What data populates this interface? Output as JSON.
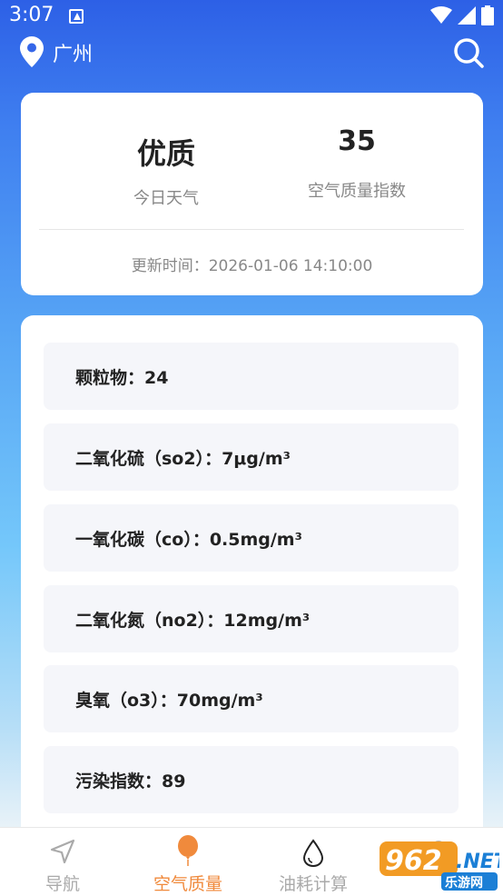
{
  "status_bar": {
    "time": "3:07",
    "icons": [
      "app-notification-icon",
      "wifi-icon",
      "cellular-icon",
      "battery-icon"
    ]
  },
  "header": {
    "city": "广州",
    "icons": [
      "location-pin-icon",
      "search-icon"
    ]
  },
  "summary": {
    "quality": "优质",
    "quality_label": "今日天气",
    "aqi": "35",
    "aqi_label": "空气质量指数",
    "update_label": "更新时间：",
    "update_time": "2026-01-06 14:10:00"
  },
  "pollutants": [
    {
      "label": "颗粒物：24"
    },
    {
      "label": "二氧化硫（so2）：7μg/m³"
    },
    {
      "label": "一氧化碳（co）：0.5mg/m³"
    },
    {
      "label": "二氧化氮（no2）：12mg/m³"
    },
    {
      "label": "臭氧（o3）：70mg/m³"
    },
    {
      "label": "污染指数：89"
    }
  ],
  "bottom_nav": {
    "items": [
      {
        "label": "导航",
        "icon": "navigation-arrow-icon",
        "active": false
      },
      {
        "label": "空气质量",
        "icon": "balloon-icon",
        "active": true
      },
      {
        "label": "油耗计算",
        "icon": "droplet-icon",
        "active": false
      },
      {
        "label": "",
        "icon": "profile-icon",
        "active": false
      }
    ]
  },
  "watermark": {
    "brand": "962.NET",
    "subtitle": "乐游网"
  },
  "colors": {
    "accent": "#f08a3c",
    "header_blue": "#2d60e6",
    "card_item_bg": "#f5f6fa"
  }
}
